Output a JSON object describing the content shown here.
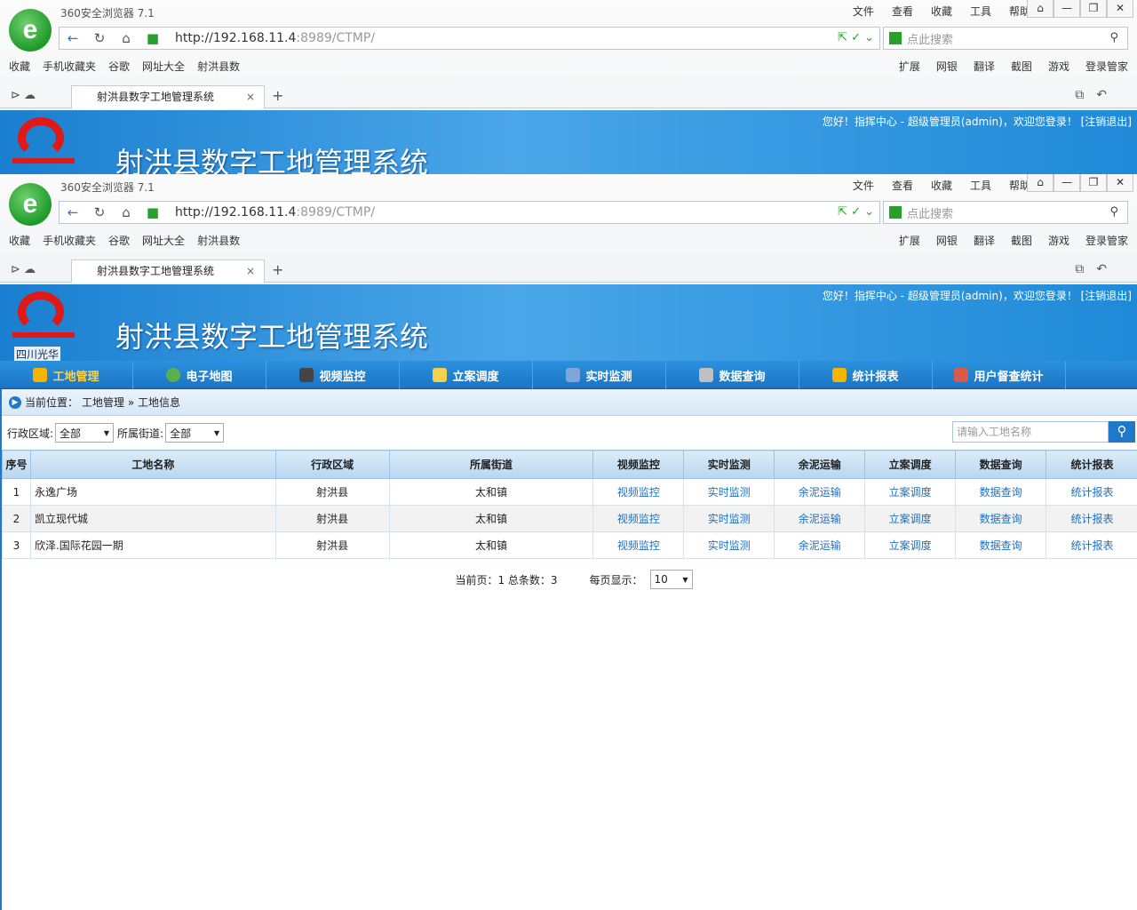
{
  "browser": {
    "title": "360安全浏览器 7.1",
    "logo_letter": "e",
    "menu": [
      "文件",
      "查看",
      "收藏",
      "工具",
      "帮助"
    ],
    "window_controls": [
      "⌂",
      "—",
      "❐",
      "✕"
    ],
    "url_host": "http://192.168.11.4",
    "url_rest": ":8989/CTMP/",
    "search_placeholder": "点此搜索",
    "favorites": [
      "收藏",
      "手机收藏夹",
      "谷歌",
      "网址大全",
      "射洪县数"
    ],
    "toolbar_right": [
      "扩展",
      "网银",
      "翻译",
      "截图",
      "游戏",
      "登录管家"
    ],
    "tab_title": "射洪县数字工地管理系统"
  },
  "banner": {
    "title": "射洪县数字工地管理系统",
    "logo_caption": "四川光华",
    "user_text": "您好！指挥中心 - 超级管理员(admin)，欢迎您登录！ [注销退出]"
  },
  "nav": [
    {
      "label": "工地管理",
      "icon": "crane-icon",
      "color": "#f5b400"
    },
    {
      "label": "电子地图",
      "icon": "globe-icon",
      "color": "#5bb04a"
    },
    {
      "label": "视频监控",
      "icon": "camera-icon",
      "color": "#444444"
    },
    {
      "label": "立案调度",
      "icon": "note-icon",
      "color": "#f2d24a"
    },
    {
      "label": "实时监测",
      "icon": "monitor-icon",
      "color": "#7fa6d8"
    },
    {
      "label": "数据查询",
      "icon": "magnifier-icon",
      "color": "#c0c0c0"
    },
    {
      "label": "统计报表",
      "icon": "bar-chart-icon",
      "color": "#f5b400"
    },
    {
      "label": "用户督查统计",
      "icon": "report-icon",
      "color": "#d85a4a"
    }
  ],
  "breadcrumb": {
    "prefix": "当前位置：",
    "path": "工地管理 » 工地信息"
  },
  "filters": {
    "region_label": "行政区域:",
    "region_value": "全部",
    "street_label": "所属街道:",
    "street_value": "全部",
    "search_placeholder": "请输入工地名称"
  },
  "table": {
    "headers": [
      "序号",
      "工地名称",
      "行政区域",
      "所属街道",
      "视频监控",
      "实时监测",
      "余泥运输",
      "立案调度",
      "数据查询",
      "统计报表"
    ],
    "rows": [
      {
        "no": "1",
        "name": "永逸广场",
        "region": "射洪县",
        "street": "太和镇"
      },
      {
        "no": "2",
        "name": "凯立现代城",
        "region": "射洪县",
        "street": "太和镇"
      },
      {
        "no": "3",
        "name": "欣泽.国际花园一期",
        "region": "射洪县",
        "street": "太和镇"
      }
    ],
    "links": [
      "视频监控",
      "实时监测",
      "余泥运输",
      "立案调度",
      "数据查询",
      "统计报表"
    ]
  },
  "pager": {
    "info": "当前页：1 总条数：3",
    "per_page_label": "每页显示：",
    "per_page_value": "10"
  }
}
